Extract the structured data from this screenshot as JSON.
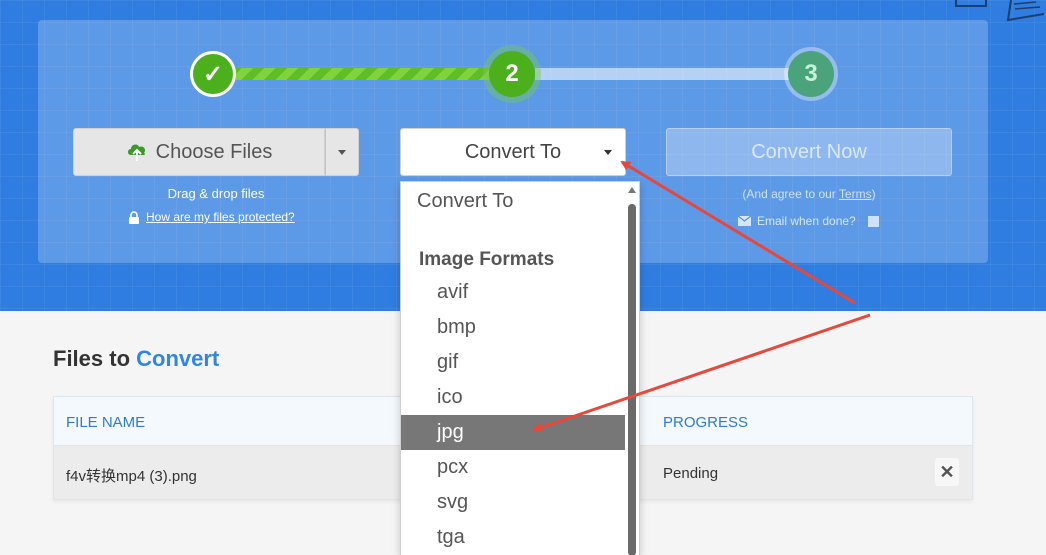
{
  "steps": {
    "step1_mark": "✓",
    "step2_label": "2",
    "step3_label": "3"
  },
  "choose": {
    "label": "Choose Files",
    "drag_text": "Drag & drop files",
    "protect_link": "How are my files protected?"
  },
  "convert_to": {
    "label": "Convert To"
  },
  "convert_now": {
    "label": "Convert Now",
    "agree_prefix": "(And agree to our ",
    "terms_link": "Terms",
    "agree_suffix": ")",
    "email_label": "Email when done?"
  },
  "files": {
    "heading_prefix": "Files to ",
    "heading_accent": "Convert",
    "columns": {
      "name": "FILE NAME",
      "progress": "PROGRESS"
    },
    "rows": [
      {
        "name": "f4v转换mp4 (3).png",
        "progress": "Pending",
        "remove": "✕"
      }
    ]
  },
  "dropdown": {
    "header": "Convert To",
    "group": "Image Formats",
    "items": [
      "avif",
      "bmp",
      "gif",
      "ico",
      "jpg",
      "pcx",
      "svg",
      "tga"
    ],
    "selected": "jpg"
  },
  "colors": {
    "hero_blue": "#2f7de0",
    "step_green": "#4caf1c",
    "link_blue": "#2f86e4",
    "arrow_red": "#e8473c"
  }
}
